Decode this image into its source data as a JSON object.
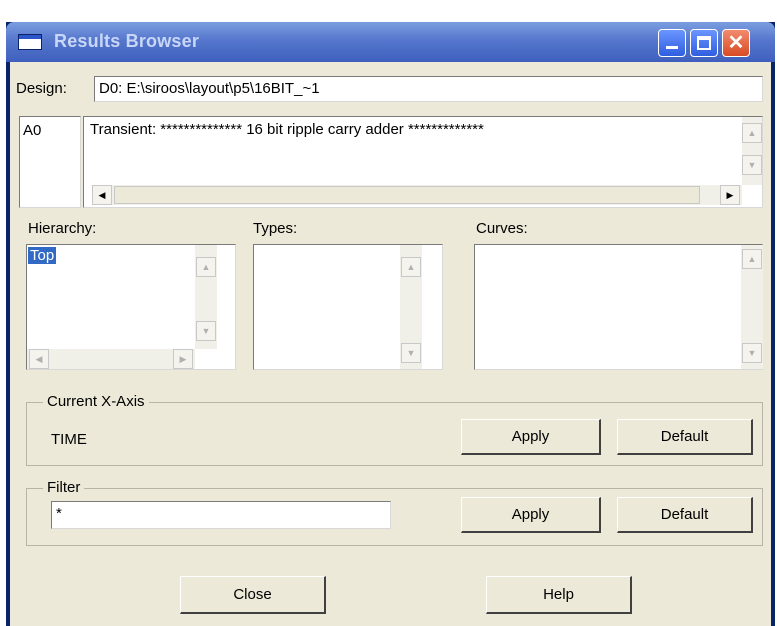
{
  "window": {
    "title": "Results Browser",
    "minimize_icon": "minimize-icon",
    "maximize_icon": "maximize-icon",
    "close_icon": "close-icon"
  },
  "design": {
    "label": "Design:",
    "value": "D0: E:\\siroos\\layout\\p5\\16BIT_~1"
  },
  "analysis": {
    "id": "A0",
    "description": "Transient: ************** 16 bit ripple carry adder  *************"
  },
  "hierarchy": {
    "label": "Hierarchy:",
    "items": [
      "Top"
    ],
    "selected": "Top"
  },
  "types": {
    "label": "Types:",
    "items": []
  },
  "curves": {
    "label": "Curves:",
    "items": []
  },
  "xaxis": {
    "group_label": "Current X-Axis",
    "value": "TIME",
    "apply_label": "Apply",
    "default_label": "Default"
  },
  "filter": {
    "group_label": "Filter",
    "value": "*",
    "apply_label": "Apply",
    "default_label": "Default"
  },
  "footer": {
    "close_label": "Close",
    "help_label": "Help"
  }
}
